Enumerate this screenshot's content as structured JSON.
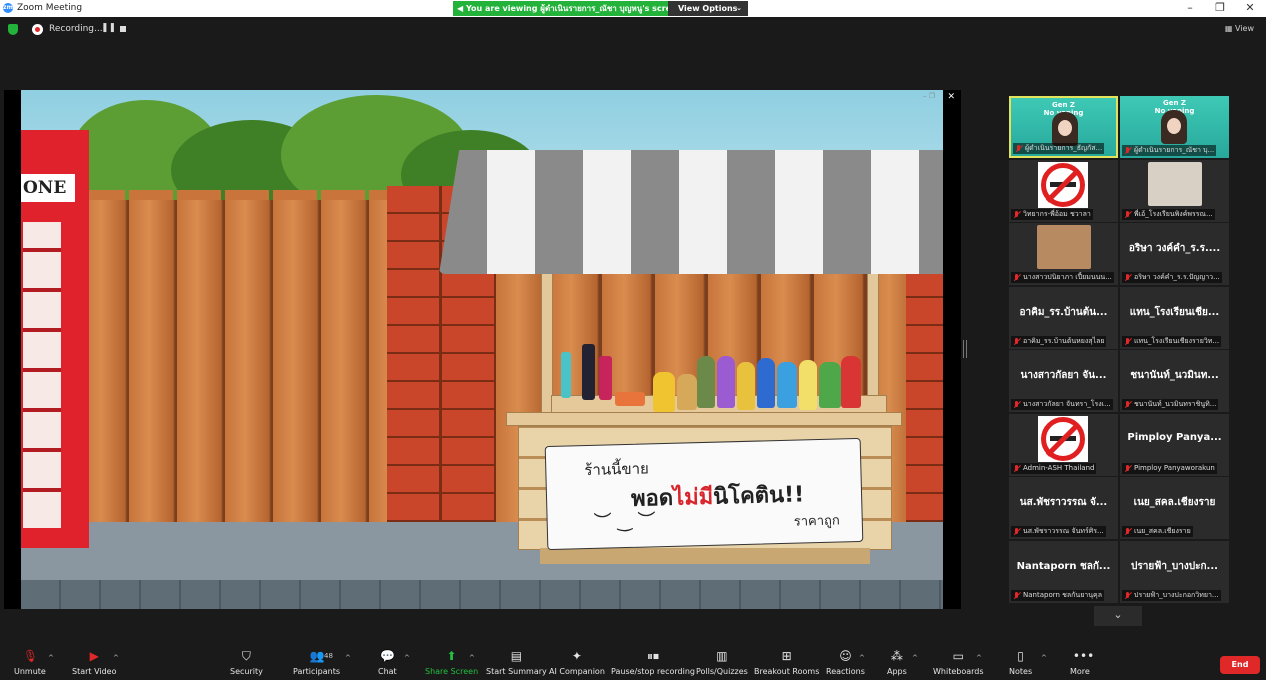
{
  "window": {
    "title": "Zoom Meeting",
    "viewing_banner": "You are viewing ผู้ดำเนินรายการ_ณัชา บุญหนู's screen",
    "view_options": "View Options"
  },
  "recording": {
    "label": "Recording...",
    "view_label": "View"
  },
  "shared_screen": {
    "phone_sign": "ONE",
    "banner_line1": "ร้านนี้ขาย",
    "banner_line2a": "พอด",
    "banner_line2b": "ไม่มี",
    "banner_line2c": "นิโคติน!!",
    "banner_smile": "︶ ‿ ︶",
    "banner_line3": "ราคาถูก"
  },
  "gallery": {
    "tiles": [
      {
        "big": "",
        "label": "ผู้ดำเนินรายการ_ธัญกัส...",
        "kind": "gen",
        "gen_text": "Gen Z\nNo vaping",
        "active": true
      },
      {
        "big": "",
        "label": "ผู้ดำเนินรายการ_ณัชา บุ...",
        "kind": "gen",
        "gen_text": "Gen Z\nNo vaping",
        "active": false
      },
      {
        "big": "",
        "label": "วิทยากร-พี่อ้อม ชวาลา",
        "kind": "nosmoke"
      },
      {
        "big": "",
        "label": "พี่เอ้_โรงเรียนพิงค์พรรณ...",
        "kind": "photo",
        "color": "#d8d0c4"
      },
      {
        "big": "",
        "label": "นางสาวปนิยาภา เปี้ยมนนน...",
        "kind": "photo",
        "color": "#b88a62"
      },
      {
        "big": "อริษา วงค์คำ_ร.ร....",
        "label": "อริษา วงค์คำ_ร.ร.ปัญญาว...",
        "kind": "name"
      },
      {
        "big": "อาคิม_รร.บ้านต้น...",
        "label": "อาคิม_รร.บ้านต้นหยงสุไลย",
        "kind": "name"
      },
      {
        "big": "แทน_โรงเรียนเชีย...",
        "label": "แทน_โรงเรียนเชียงรายวิท...",
        "kind": "name"
      },
      {
        "big": "นางสาวกัลยา จัน...",
        "label": "นางสาวกัลยา จันทรา_โรงเ...",
        "kind": "name"
      },
      {
        "big": "ชนานันท์_นวมินท...",
        "label": "ชนานันท์_นวมินทราชินูทิ...",
        "kind": "name"
      },
      {
        "big": "",
        "label": "Admin-ASH Thailand",
        "kind": "nosmoke"
      },
      {
        "big": "Pimploy  Panya...",
        "label": "Pimploy Panyaworakun",
        "kind": "name"
      },
      {
        "big": "นส.พัชราวรรณ จั...",
        "label": "นส.พัชราวรรณ จันทร์ศิร...",
        "kind": "name"
      },
      {
        "big": "เนย_สคล.เชียงราย",
        "label": "เนย_สคล.เชียงราย",
        "kind": "name"
      },
      {
        "big": "Nantaporn ชลกั...",
        "label": "Nantaporn ชลกันยานุคุล",
        "kind": "name"
      },
      {
        "big": "ปรายฟ้า_บางปะก...",
        "label": "ปรายฟ้า_บางปะกอกวิทยา...",
        "kind": "name"
      }
    ]
  },
  "toolbar": {
    "unmute": "Unmute",
    "start_video": "Start Video",
    "security": "Security",
    "participants": "Participants",
    "participants_count": "48",
    "chat": "Chat",
    "share_screen": "Share Screen",
    "start_summary": "Start Summary",
    "ai_companion": "AI Companion",
    "pause_recording": "Pause/stop recording",
    "polls": "Polls/Quizzes",
    "breakout": "Breakout Rooms",
    "reactions": "Reactions",
    "apps": "Apps",
    "whiteboards": "Whiteboards",
    "notes": "Notes",
    "more": "More",
    "end": "End"
  },
  "colors": {
    "accent_green": "#23b33b",
    "end_red": "#e02828",
    "active_border": "#e0e35b"
  }
}
